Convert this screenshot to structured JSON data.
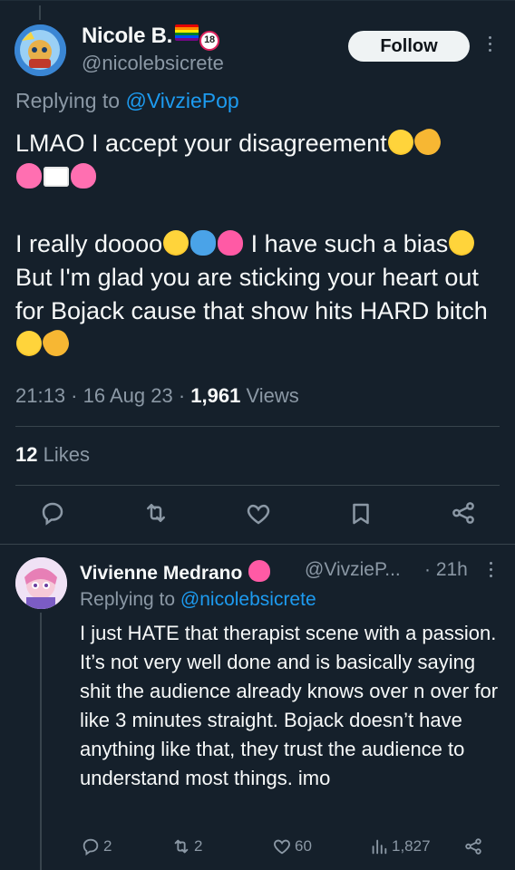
{
  "main_tweet": {
    "display_name": "Nicole B.",
    "badge_18": "18",
    "handle": "@nicolebsicrete",
    "follow_label": "Follow",
    "replying_prefix": "Replying to",
    "replying_to": "@VivziePop",
    "line1": "LMAO I accept your disagreement",
    "para2_start": "I really doooo",
    "para2_mid": " I have such a bias",
    "para2_cont": " But I'm glad you are sticking your heart out for Bojack cause that show hits HARD bitch",
    "time": "21:13",
    "date": "16 Aug 23",
    "views_count": "1,961",
    "views_label": "Views",
    "likes_count": "12",
    "likes_label": "Likes",
    "emoji": [
      "rofl-emoji",
      "clap-emoji",
      "revolving-hearts-emoji",
      "love-letter-emoji",
      "loudly-crying-emoji",
      "people-hugging-emoji",
      "sparkling-heart-emoji",
      "grinning-sweat-emoji"
    ]
  },
  "reply_tweet": {
    "display_name": "Vivienne Medrano",
    "handle": "@VivzieP...",
    "time": "· 21h",
    "replying_prefix": "Replying to",
    "replying_to": "@nicolebsicrete",
    "text": "I just HATE that therapist scene with a passion. It’s not very well done and is basically saying shit the audience already knows over n over for like 3 minutes straight. Bojack doesn’t have anything like that, they trust the audience to understand most things. imo",
    "replies": "2",
    "retweets": "2",
    "likes": "60",
    "views": "1,827"
  },
  "colors": {
    "background": "#15202b",
    "text": "#f7f9f9",
    "muted": "#8b98a5",
    "link": "#1d9bf0",
    "divider": "#38444d"
  },
  "icons": [
    "reply-icon",
    "retweet-icon",
    "like-icon",
    "bookmark-icon",
    "share-icon",
    "views-icon",
    "more-icon"
  ]
}
